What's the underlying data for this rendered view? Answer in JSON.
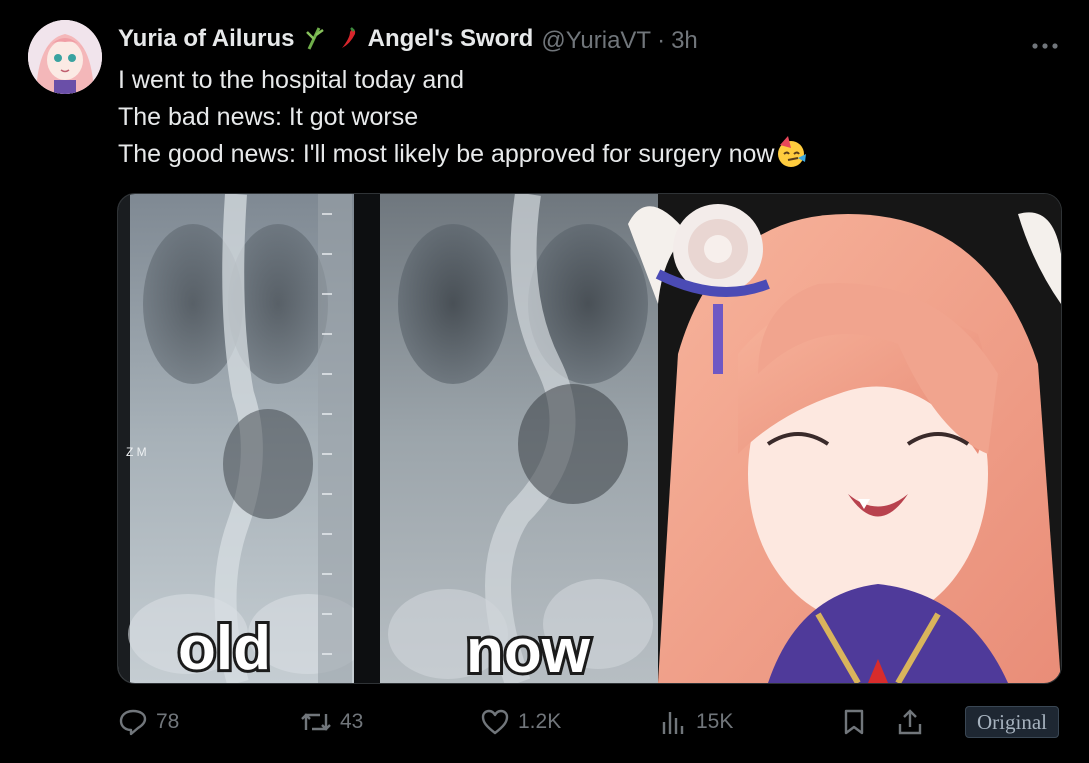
{
  "post": {
    "display_name_part1": "Yuria of Ailurus",
    "display_name_part2": "Angel's Sword",
    "handle": "@YuriaVT",
    "separator": "·",
    "time": "3h",
    "lines": [
      "I went to the hospital today and",
      "The bad news: It got worse",
      "The good news: I'll most likely be approved for surgery now"
    ]
  },
  "media": {
    "label_old": "old",
    "label_now": "now",
    "marker": "Z M"
  },
  "stats": {
    "replies": "78",
    "reposts": "43",
    "likes": "1.2K",
    "views": "15K"
  },
  "original_button": "Original",
  "icons": [
    "bamboo-icon",
    "chili-icon",
    "party-face-emoji",
    "more-icon",
    "reply-icon",
    "repost-icon",
    "like-icon",
    "views-icon",
    "bookmark-icon",
    "share-icon"
  ],
  "colors": {
    "background": "#000000",
    "text": "#e7e9ea",
    "secondary": "#71767b",
    "border": "#2f3336"
  }
}
